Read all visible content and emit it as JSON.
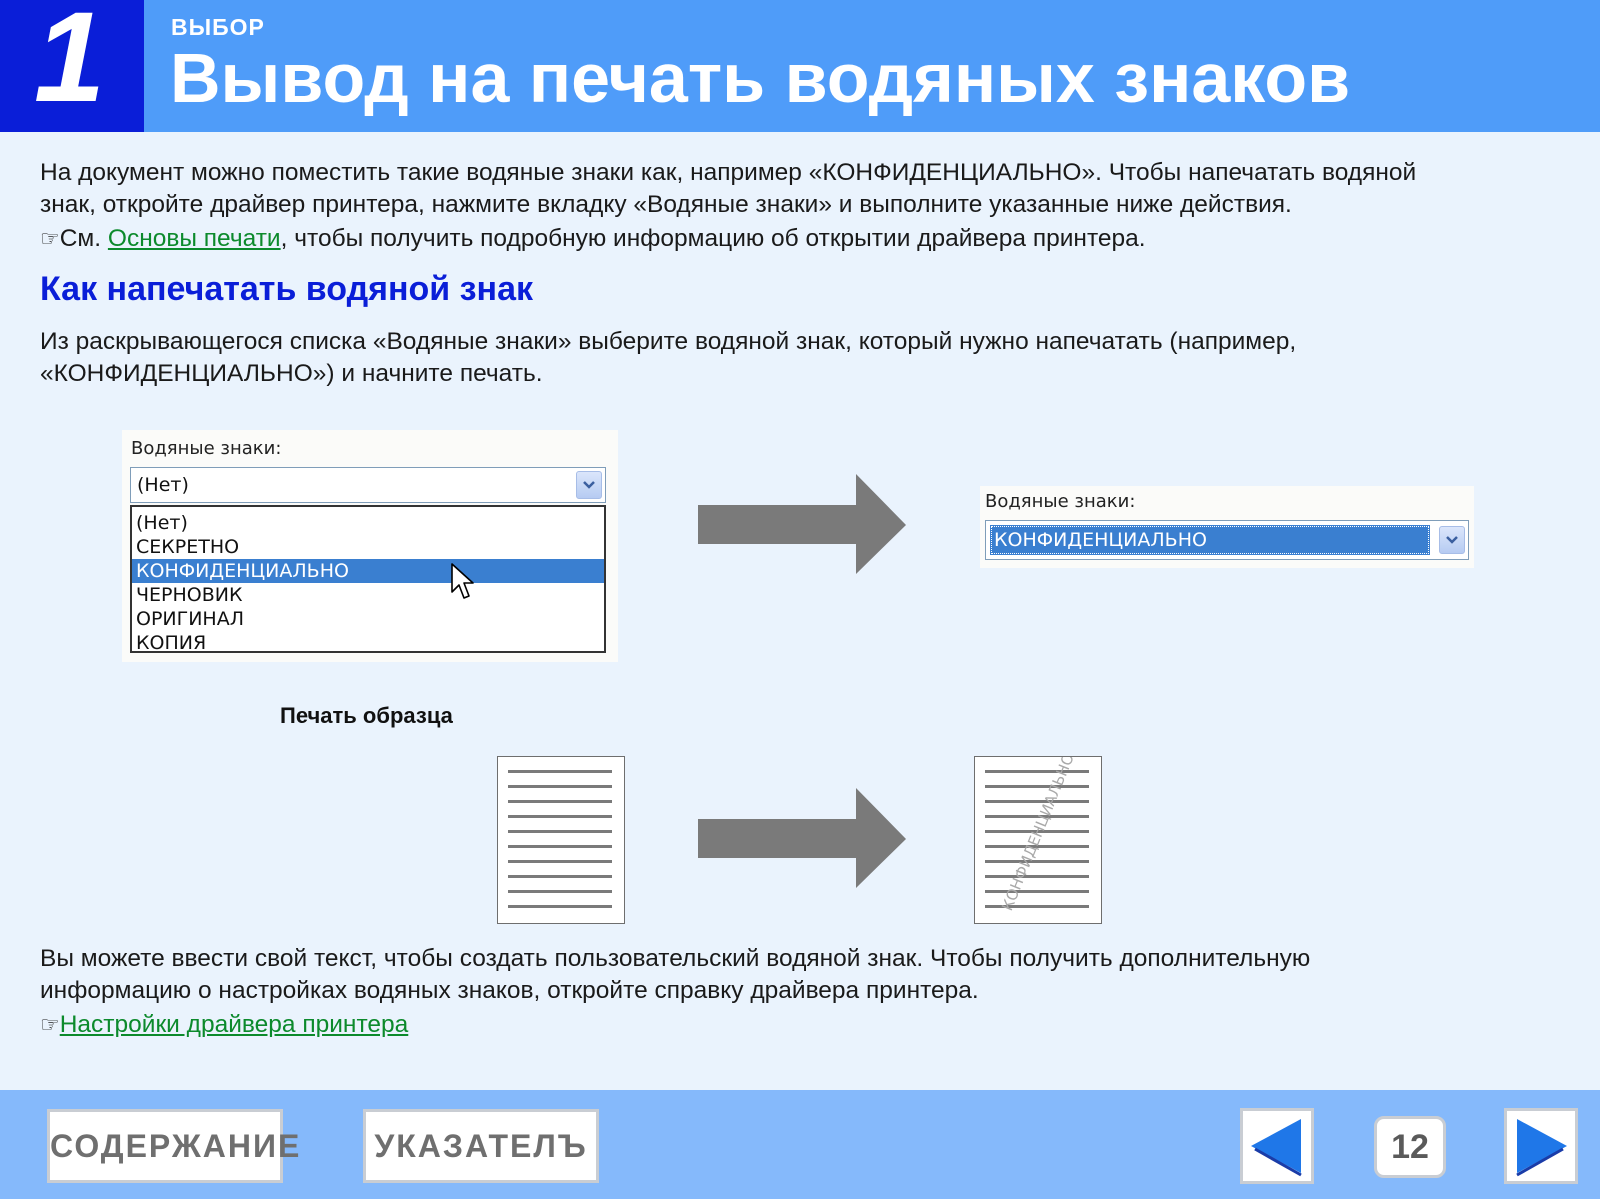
{
  "header": {
    "number": "1",
    "eyebrow": "ВЫБОР",
    "title": "Вывод на печать водяных знаков"
  },
  "intro": {
    "line1": "На документ можно поместить такие водяные знаки как, например «КОНФИДЕНЦИАЛЬНО». Чтобы напечатать водяной",
    "line2": "знак, откройте драйвер принтера, нажмите вкладку «Водяные знаки» и выполните указанные ниже действия.",
    "ref_prefix": "См. ",
    "ref_link": "Основы печати",
    "ref_suffix": ", чтобы получить подробную информацию об открытии драйвера принтера."
  },
  "section": {
    "heading": "Как напечатать водяной знак",
    "line1": "Из раскрывающегося списка «Водяные знаки» выберите водяной знак, который нужно напечатать (например,",
    "line2": "«КОНФИДЕНЦИАЛЬНО») и начните печать."
  },
  "dialog_before": {
    "label": "Водяные знаки:",
    "current_value": "(Нет)",
    "options": [
      "(Нет)",
      "СЕКРЕТНО",
      "КОНФИДЕНЦИАЛЬНО",
      "ЧЕРНОВИК",
      "ОРИГИНАЛ",
      "КОПИЯ"
    ],
    "highlighted_option": "КОНФИДЕНЦИАЛЬНО"
  },
  "dialog_after": {
    "label": "Водяные знаки:",
    "current_value": "КОНФИДЕНЦИАЛЬНО"
  },
  "sample": {
    "caption": "Печать образца",
    "watermark_text": "КОНФИДЕНЦИАЛЬНО"
  },
  "outro": {
    "line1": "Вы можете ввести свой текст, чтобы создать пользовательский водяной знак. Чтобы получить дополнительную",
    "line2": "информацию о настройках водяных знаков, откройте справку драйвера принтера.",
    "ref_link": "Настройки драйвера принтера"
  },
  "ref_glyph": "☞",
  "footer": {
    "contents_label": "СОДЕРЖАНИЕ",
    "index_label": "УКАЗАТЕЛЪ",
    "page_number": "12",
    "prev_icon": "left-triangle-icon",
    "next_icon": "right-triangle-icon"
  },
  "colors": {
    "header_bg": "#4f9cf9",
    "header_number_bg": "#0a1ed8",
    "heading": "#0a1ed8",
    "link": "#0c8a2c",
    "footer_bg": "#85b9fb",
    "selection": "#3a7fd0"
  }
}
